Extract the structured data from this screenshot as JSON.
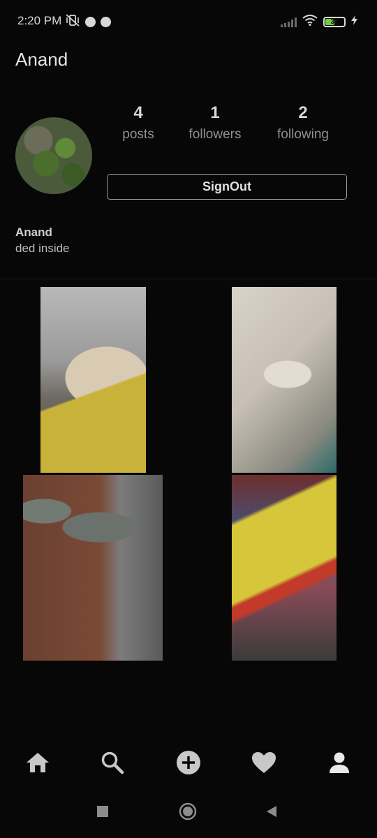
{
  "status_bar": {
    "time": "2:20 PM",
    "battery": "38",
    "icons": [
      "vibrate-off-icon",
      "app-badge-icon",
      "app-badge-icon",
      "signal-icon",
      "wifi-icon",
      "battery-icon",
      "charging-icon"
    ]
  },
  "profile": {
    "username": "Anand",
    "display_name": "Anand",
    "bio": "ded inside",
    "stats": [
      {
        "count": "4",
        "label": "posts"
      },
      {
        "count": "1",
        "label": "followers"
      },
      {
        "count": "2",
        "label": "following"
      }
    ],
    "signout_label": "SignOut"
  },
  "posts": [
    {
      "subject": "dog"
    },
    {
      "subject": "bandaged hand"
    },
    {
      "subject": "shoes"
    },
    {
      "subject": "ratol packet"
    }
  ],
  "bottom_nav": [
    "home-icon",
    "search-icon",
    "add-post-icon",
    "activity-heart-icon",
    "profile-icon"
  ],
  "system_nav": [
    "recents-button",
    "home-button",
    "back-button"
  ],
  "colors": {
    "background": "#070707",
    "text": "#d8d8d8",
    "muted": "#8f8f8f",
    "icon": "#c8c8c8"
  }
}
